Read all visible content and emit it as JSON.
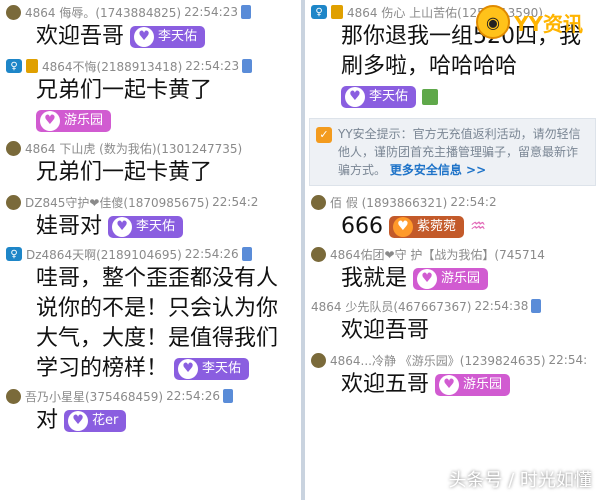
{
  "left_messages": [
    {
      "user": "4864 侮辱。(1743884825)",
      "time": "22:54:23",
      "text": "欢迎吾哥",
      "tag": "李天佑",
      "tag_color": "purple"
    },
    {
      "user": "4864不悔(2188913418)",
      "time": "22:54:23",
      "text": "兄弟们一起卡黄了",
      "tag": "游乐园",
      "tag_color": "pink",
      "tag_on_new_line": true
    },
    {
      "user": "4864 下山虎 (数为我佑)(1301247735)",
      "time": "",
      "text": "兄弟们一起卡黄了",
      "tag": "",
      "tag_color": ""
    },
    {
      "user": "DZ845守护❤佳傻(1870985675)",
      "time": "22:54:2",
      "text": "娃哥对",
      "tag": "李天佑",
      "tag_color": "purple"
    },
    {
      "user": "Dz4864天啊(2189104695)",
      "time": "22:54:26",
      "lines": [
        "哇哥，整个歪歪都没有人",
        "说你的不是！只会认为你",
        "大气，大度！是值得我们",
        "学习的榜样！"
      ],
      "tag": "李天佑",
      "tag_color": "purple"
    },
    {
      "user": "吾乃小星星(375468459)",
      "time": "22:54:26",
      "text": "对",
      "tag": "花er",
      "tag_color": "purple"
    }
  ],
  "right_messages": [
    {
      "user": "4864  伤心  上山苦佑(1259213590)",
      "time": "",
      "lines": [
        "那你退我一组520四，我",
        "刷多啦，哈哈哈哈"
      ],
      "tag": "李天佑",
      "tag_color": "purple"
    },
    {
      "user": "佰  假  (1893866321)",
      "time": "22:54:2",
      "text": "666",
      "tag": "紫菀菀",
      "tag_color": "orange"
    },
    {
      "user": "4864佑团❤守 护【战为我佑】(745714",
      "time": "",
      "text": "我就是",
      "tag": "游乐园",
      "tag_color": "pink"
    },
    {
      "user": "4864 少先队员(467667367)",
      "time": "22:54:38",
      "text": "欢迎吾哥",
      "tag": "",
      "tag_color": ""
    },
    {
      "user": "4864...冷静 《游乐园》(1239824635)",
      "time": "22:54:",
      "text": "欢迎五哥",
      "tag": "游乐园",
      "tag_color": "pink"
    }
  ],
  "system_notice": {
    "text": "YY安全提示：官方无充值返利活动，请勿轻信他人，谨防团首充主播管理骗子，留意最新诈骗方式。",
    "link": "更多安全信息 >>"
  },
  "logo_text": "YY资讯",
  "watermark": "头条号 / 时光如懂",
  "colors": {
    "purple_tag": "#8a5ee0",
    "pink_tag": "#d15bd1",
    "orange_tag": "#c35a2a",
    "link": "#1e73c8"
  }
}
